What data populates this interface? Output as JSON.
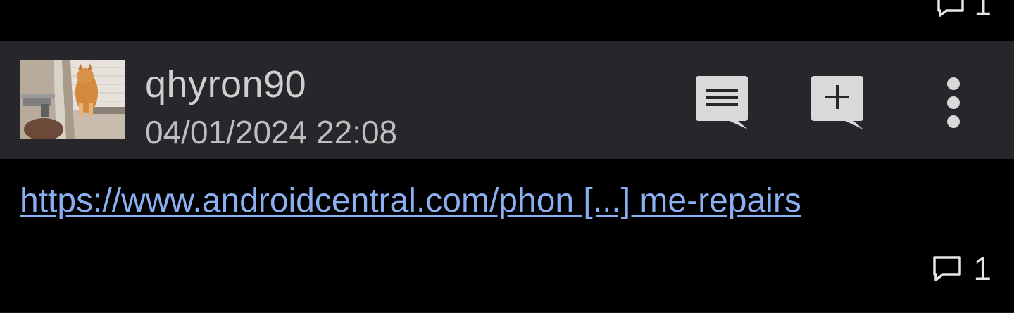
{
  "previous_post": {
    "reply_count": "1",
    "reply_icon": "comment-icon"
  },
  "post": {
    "username": "qhyron90",
    "timestamp": "04/01/2024 22:08",
    "avatar_icon": "user-avatar-kitten",
    "actions": {
      "comments_icon": "comments-list-icon",
      "add_comment_icon": "add-comment-icon",
      "more_icon": "more-vert-icon"
    },
    "link_text": "https://www.androidcentral.com/phon [...] me-repairs",
    "reply_count": "1",
    "reply_icon": "comment-icon"
  },
  "colors": {
    "header_bg": "#27262b",
    "page_bg": "#000000",
    "link": "#8ab0f2",
    "icon_fill": "#d9d9d9"
  }
}
